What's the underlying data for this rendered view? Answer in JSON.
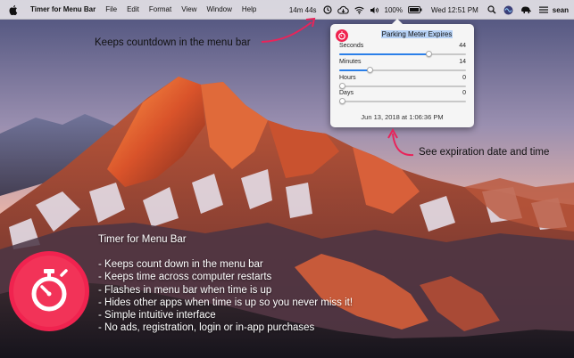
{
  "menubar": {
    "app_name": "Timer for Menu Bar",
    "menus": [
      "File",
      "Edit",
      "Format",
      "View",
      "Window",
      "Help"
    ],
    "countdown": "14m 44s",
    "battery_percent": "100%",
    "clock": "Wed 12:51 PM",
    "user": "sean",
    "icons": [
      "apple-icon",
      "timer-icon",
      "cloud-icon",
      "wifi-icon",
      "volume-icon",
      "battery-icon",
      "search-icon",
      "siri-icon",
      "elephant-icon",
      "menu-icon"
    ]
  },
  "popover": {
    "title": "Parking Meter Expires",
    "sliders": [
      {
        "label": "Seconds",
        "value": "44",
        "fraction": 0.72
      },
      {
        "label": "Minutes",
        "value": "14",
        "fraction": 0.23
      },
      {
        "label": "Hours",
        "value": "0",
        "fraction": 0.0
      },
      {
        "label": "Days",
        "value": "0",
        "fraction": 0.0
      }
    ],
    "expiry": "Jun 13, 2018 at 1:06:36 PM",
    "accent_color": "#2b7fe8",
    "icon_color": "#f0234f"
  },
  "callouts": {
    "menu_bar": "Keeps countdown in the menu bar",
    "expiration": "See expiration date and time",
    "arrow_color": "#e8245a"
  },
  "features": {
    "heading": "Timer for Menu Bar",
    "items": [
      "- Keeps count down in the menu bar",
      "- Keeps time across computer restarts",
      "- Flashes in menu bar when time is up",
      "- Hides other apps when time is up so you never miss it!",
      "- Simple intuitive interface",
      "- No ads, registration, login or in-app purchases"
    ]
  }
}
